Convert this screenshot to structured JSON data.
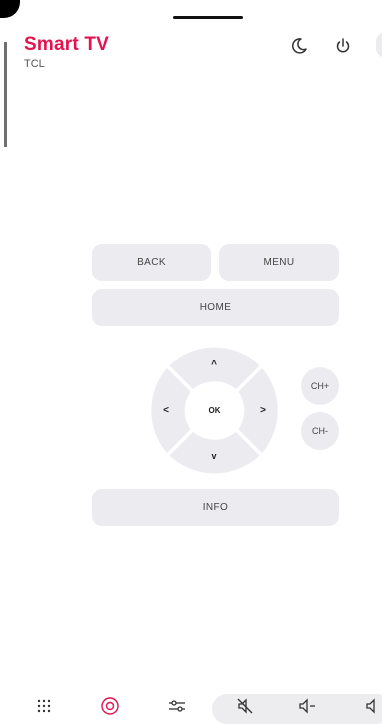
{
  "header": {
    "title": "Smart TV",
    "subtitle": "TCL"
  },
  "icons": {
    "sleep": "moon-icon",
    "power": "power-icon"
  },
  "remote": {
    "back": "BACK",
    "menu": "MENU",
    "home": "HOME",
    "ok": "OK",
    "up": "^",
    "down": "v",
    "left": "<",
    "right": ">",
    "ch_up": "CH+",
    "ch_down": "CH-",
    "info": "INFO"
  },
  "bottom_nav": {
    "items": [
      "keypad-icon",
      "dpad-icon",
      "settings-sliders-icon",
      "mute-icon",
      "volume-down-icon",
      "volume-up-icon"
    ],
    "vol_down_label": "−",
    "vol_up_label": "+",
    "active_color": "#e5124f"
  },
  "colors": {
    "accent": "#e5124f",
    "button": "#ececf0"
  }
}
